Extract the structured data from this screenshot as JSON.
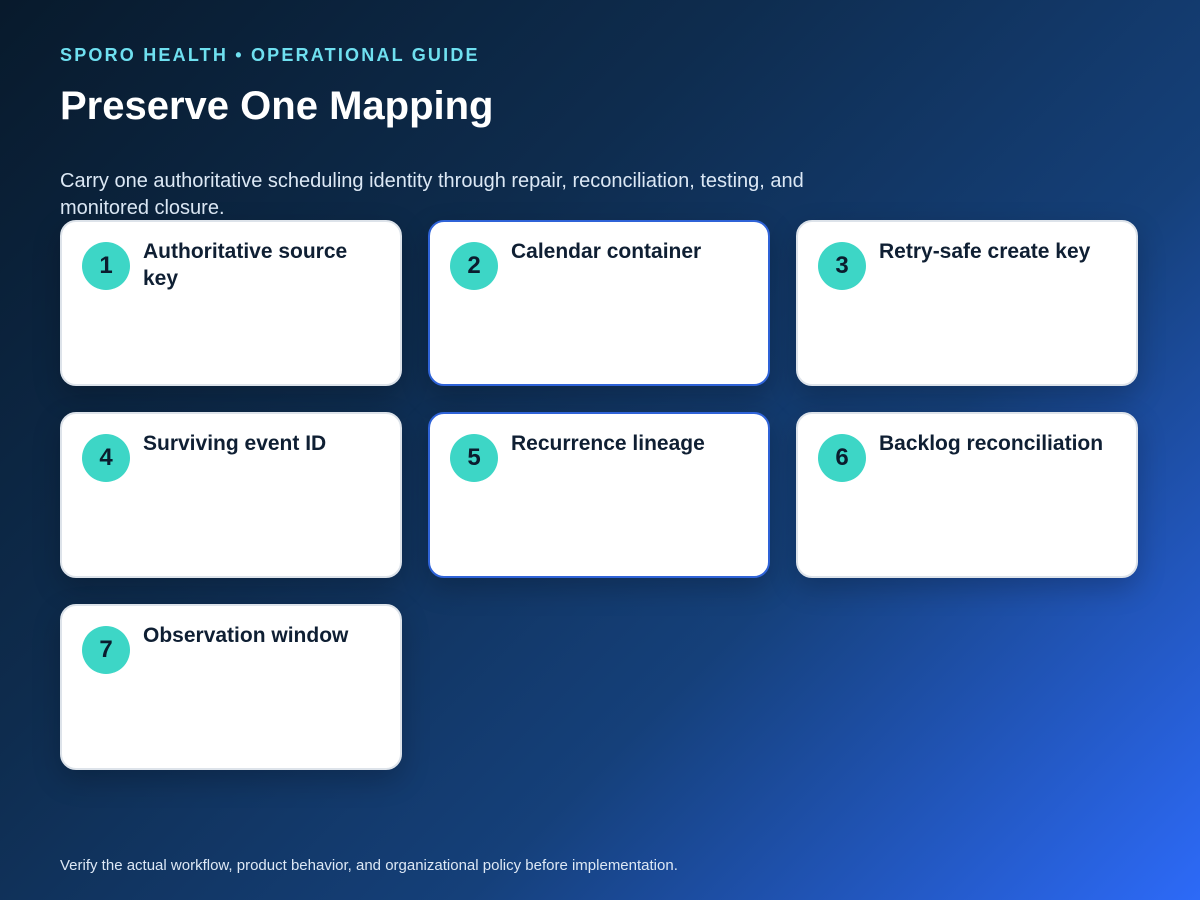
{
  "header": {
    "eyebrow": "SPORO HEALTH • OPERATIONAL GUIDE",
    "title": "Preserve One Mapping",
    "subtitle": "Carry one authoritative scheduling identity through repair, reconciliation, testing, and monitored closure."
  },
  "cards": [
    {
      "number": "1",
      "label": "Authoritative source key"
    },
    {
      "number": "2",
      "label": "Calendar container"
    },
    {
      "number": "3",
      "label": "Retry-safe create key"
    },
    {
      "number": "4",
      "label": "Surviving event ID"
    },
    {
      "number": "5",
      "label": "Recurrence lineage"
    },
    {
      "number": "6",
      "label": "Backlog reconciliation"
    },
    {
      "number": "7",
      "label": "Observation window"
    }
  ],
  "footer": {
    "note": "Verify the actual workflow, product behavior, and organizational policy before implementation."
  },
  "colors": {
    "accent": "#6fe0f0",
    "badge": "#3dd6c6",
    "highlight_border": "#2f63d8",
    "card_background": "#ffffff",
    "gradient_start": "#081a2c",
    "gradient_end": "#2d6af8"
  }
}
